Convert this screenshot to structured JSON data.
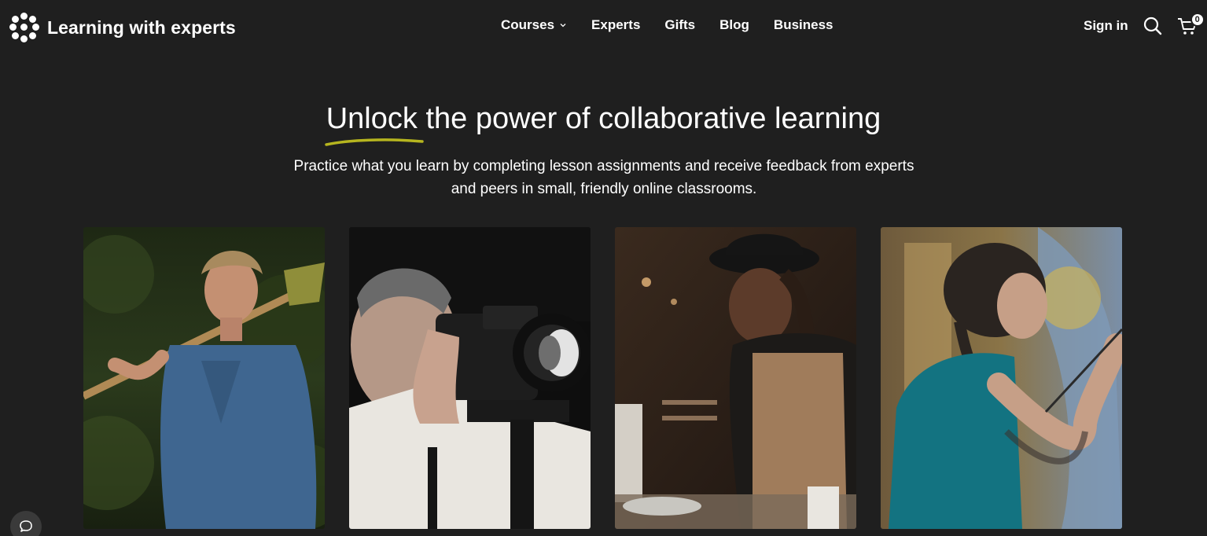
{
  "header": {
    "brand": "Learning with experts",
    "logo_icon": "dots-logo-icon",
    "nav": [
      {
        "label": "Courses",
        "has_dropdown": true
      },
      {
        "label": "Experts",
        "has_dropdown": false
      },
      {
        "label": "Gifts",
        "has_dropdown": false
      },
      {
        "label": "Blog",
        "has_dropdown": false
      },
      {
        "label": "Business",
        "has_dropdown": false
      }
    ],
    "sign_in": "Sign in",
    "search_icon": "search-icon",
    "cart_icon": "cart-icon",
    "cart_count": "0"
  },
  "hero": {
    "title_highlight": "Unlock",
    "title_rest": " the power of collaborative learning",
    "subtitle": "Practice what you learn by completing lesson assignments and receive feedback from experts and peers in small, friendly online classrooms.",
    "underline_color": "#b6b51f"
  },
  "cards": [
    {
      "name": "gardening-expert-photo"
    },
    {
      "name": "photography-expert-photo"
    },
    {
      "name": "chef-expert-photo"
    },
    {
      "name": "painting-expert-photo"
    }
  ],
  "chat": {
    "icon": "chat-bubble-icon"
  },
  "colors": {
    "background": "#1f1f1f",
    "text": "#ffffff",
    "accent": "#b6b51f"
  }
}
